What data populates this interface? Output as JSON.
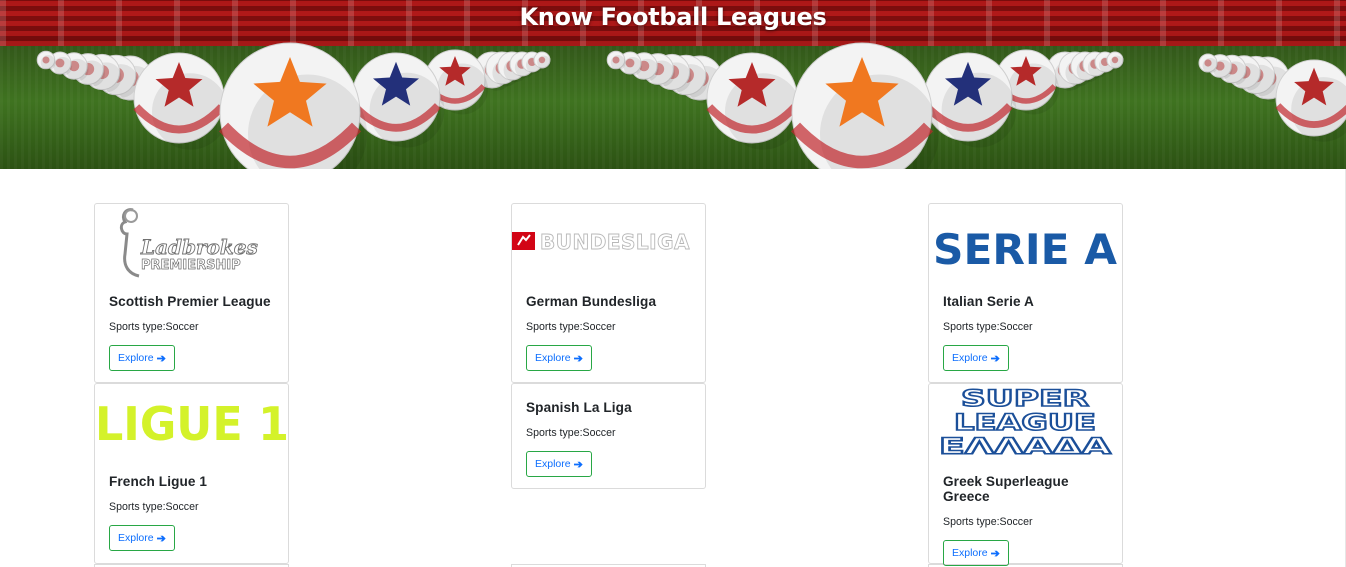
{
  "banner": {
    "title": "Know Football Leagues"
  },
  "leagues": [
    {
      "name": "Scottish Premier League",
      "sport": "Sports type:Soccer",
      "button": "Explore",
      "logo_text": "Ladbrokes",
      "logo_subtext": "PREMIERSHIP"
    },
    {
      "name": "German Bundesliga",
      "sport": "Sports type:Soccer",
      "button": "Explore",
      "logo_text": "BUNDESLIGA"
    },
    {
      "name": "Italian Serie A",
      "sport": "Sports type:Soccer",
      "button": "Explore",
      "logo_text": "SERIE A"
    },
    {
      "name": "French Ligue 1",
      "sport": "Sports type:Soccer",
      "button": "Explore",
      "logo_text": "LIGUE 1"
    },
    {
      "name": "Spanish La Liga",
      "sport": "Sports type:Soccer",
      "button": "Explore"
    },
    {
      "name": "Greek Superleague Greece",
      "sport": "Sports type:Soccer",
      "button": "Explore",
      "logo_text": "SUPER",
      "logo_text2": "LEAGUE",
      "logo_text3": "ΕΛΛΑΔΑ"
    }
  ],
  "colors": {
    "button_border": "#28a745",
    "button_text": "#0d6efd",
    "ligue1": "#d4f22a",
    "seriea": "#1a5aa6",
    "superleague": "#1b4f99"
  }
}
